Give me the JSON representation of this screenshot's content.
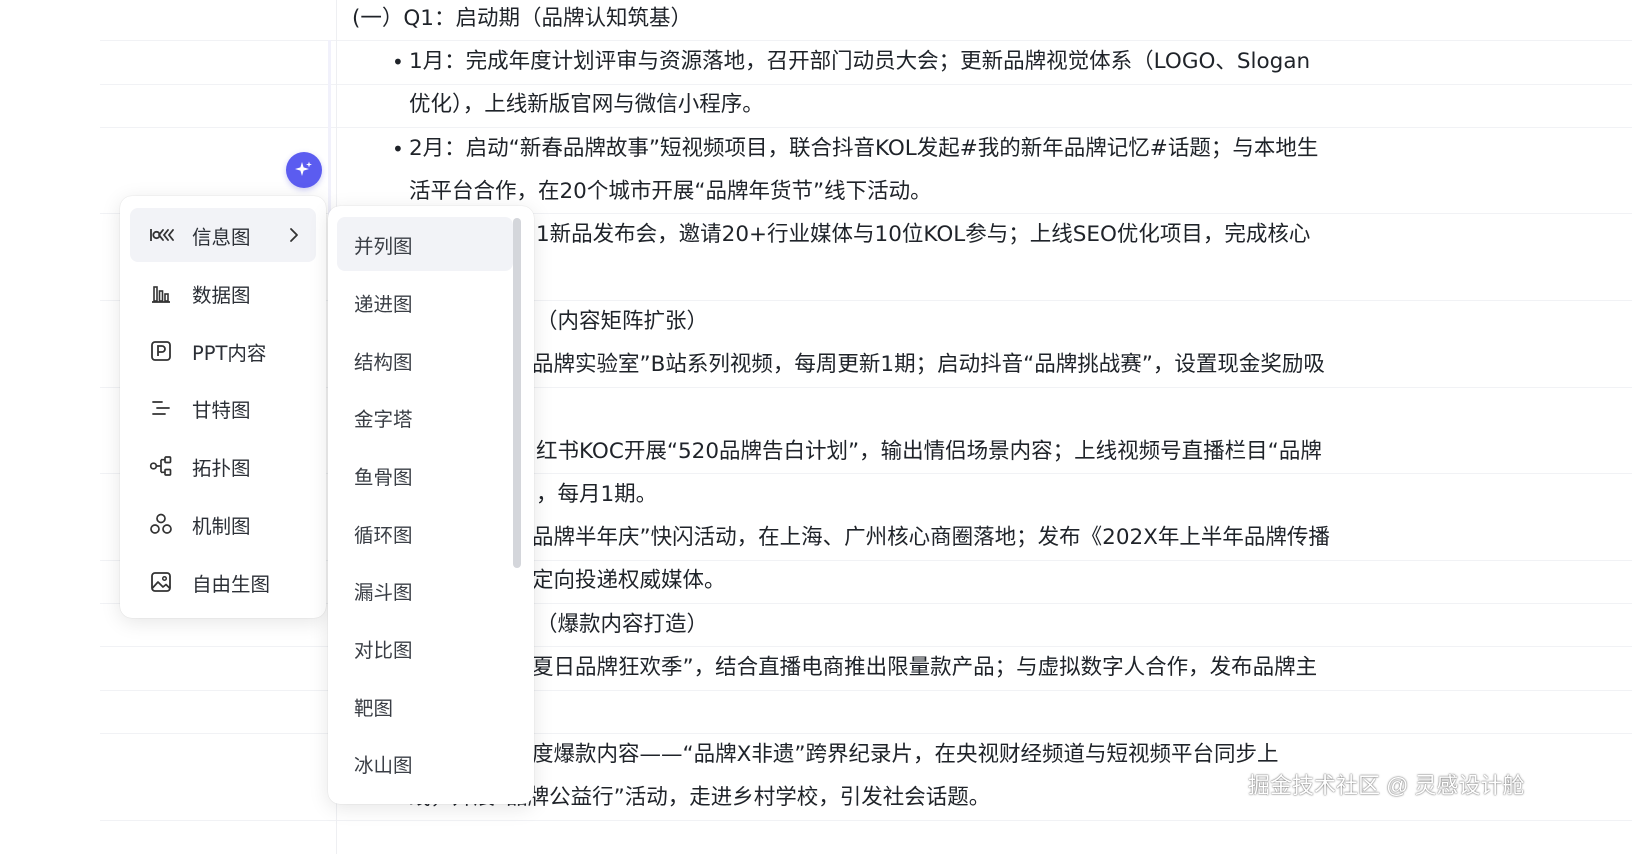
{
  "document": {
    "lines": [
      "(一）Q1：启动期（品牌认知筑基）",
      "1月：完成年度计划评审与资源落地，召开部门动员大会；更新品牌视觉体系（LOGO、Slogan",
      "优化），上线新版官网与微信小程序。",
      "2月：启动“新春品牌故事”短视频项目，联合抖音KOL发起#我的新年品牌记忆#话题；与本地生",
      "活平台合作，在20个城市开展“品牌年货节”线下活动。",
      "1新品发布会，邀请20+行业媒体与10位KOL参与；上线SEO优化项目，完成核心",
      "（内容矩阵扩张）",
      "品牌实验室”B站系列视频，每周更新1期；启动抖音“品牌挑战赛”，设置现金奖励吸",
      "红书KOC开展“520品牌告白计划”，输出情侣场景内容；上线视频号直播栏目“品牌",
      "，每月1期。",
      "品牌半年庆”快闪活动，在上海、广州核心商圈落地；发布《202X年上半年品牌传播",
      "定向投递权威媒体。",
      "（爆款内容打造）",
      "夏日品牌狂欢季”，结合直播电商推出限量款产品；与虚拟数字人合作，发布品牌主",
      "度爆款内容——“品牌X非遗”跨界纪录片，在央视财经频道与短视频平台同步上",
      "线，开展“品牌公益行”活动，走进乡村学校，引发社会话题。"
    ],
    "bullet": "•"
  },
  "menu": {
    "items": [
      {
        "label": "信息图",
        "icon": "infographic-icon"
      },
      {
        "label": "数据图",
        "icon": "bar-chart-icon"
      },
      {
        "label": "PPT内容",
        "icon": "ppt-icon"
      },
      {
        "label": "甘特图",
        "icon": "gantt-icon"
      },
      {
        "label": "拓扑图",
        "icon": "topology-icon"
      },
      {
        "label": "机制图",
        "icon": "mechanism-icon"
      },
      {
        "label": "自由生图",
        "icon": "image-icon"
      }
    ]
  },
  "submenu": {
    "items": [
      "并列图",
      "递进图",
      "结构图",
      "金字塔",
      "鱼骨图",
      "循环图",
      "漏斗图",
      "对比图",
      "靶图",
      "冰山图"
    ]
  },
  "watermark": "掘金技术社区 @ 灵感设计舱",
  "colors": {
    "accent": "#5b5cf0",
    "text": "#1f2329",
    "hover": "#f2f3f7"
  }
}
